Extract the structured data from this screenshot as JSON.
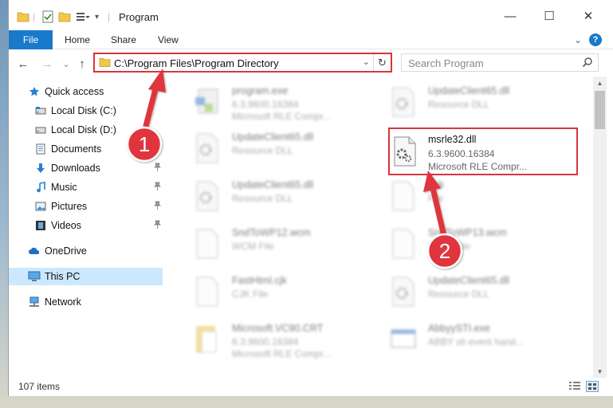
{
  "window": {
    "title": "Program",
    "minimize_glyph": "—",
    "maximize_glyph": "☐",
    "close_glyph": "✕"
  },
  "ribbon": {
    "tabs": [
      "File",
      "Home",
      "Share",
      "View"
    ],
    "expand_glyph": "⌄",
    "help_glyph": "?"
  },
  "nav": {
    "back_glyph": "←",
    "forward_glyph": "→",
    "recent_glyph": "⌄",
    "up_glyph": "↑",
    "address_path": "C:\\Program Files\\Program Directory",
    "address_dropdown_glyph": "⌄",
    "refresh_glyph": "↻",
    "search_placeholder": "Search Program"
  },
  "sidebar": {
    "items": [
      {
        "label": "Quick access",
        "icon": "star-icon"
      },
      {
        "label": "Local Disk (C:)",
        "icon": "drive-icon"
      },
      {
        "label": "Local Disk (D:)",
        "icon": "drive-icon"
      },
      {
        "label": "Documents",
        "icon": "documents-icon"
      },
      {
        "label": "Downloads",
        "icon": "download-arrow-icon",
        "pinned": true
      },
      {
        "label": "Music",
        "icon": "music-note-icon",
        "pinned": true
      },
      {
        "label": "Pictures",
        "icon": "pictures-icon",
        "pinned": true
      },
      {
        "label": "Videos",
        "icon": "film-icon",
        "pinned": true
      },
      {
        "label": "OneDrive",
        "icon": "cloud-icon"
      },
      {
        "label": "This PC",
        "icon": "monitor-icon",
        "selected": true
      },
      {
        "label": "Network",
        "icon": "network-icon"
      }
    ],
    "pin_glyph": "📌"
  },
  "files": [
    {
      "name": "program.exe",
      "line1": "6.3.9600.16384",
      "line2": "Microsoft RLE Compr...",
      "icon": "exe-icon"
    },
    {
      "name": "UpdateClient65.dll",
      "line1": "Resource DLL",
      "line2": "",
      "icon": "dll-gear-icon"
    },
    {
      "name": "UpdateClient65.dll",
      "line1": "Resource DLL",
      "line2": "",
      "icon": "dll-gear-icon"
    },
    {
      "name": "msrle32.dll",
      "line1": "6.3.9600.16384",
      "line2": "Microsoft RLE Compr...",
      "icon": "dll-gear-icon"
    },
    {
      "name": "UpdateClient65.dll",
      "line1": "Resource DLL",
      "line2": "",
      "icon": "dll-gear-icon"
    },
    {
      "name": "bak",
      "line1": "File",
      "line2": "",
      "icon": "blank-file-icon"
    },
    {
      "name": "SndToWP12.wcm",
      "line1": "WCM File",
      "line2": "",
      "icon": "blank-file-icon"
    },
    {
      "name": "SndToWP13.wcm",
      "line1": "WCM File",
      "line2": "",
      "icon": "blank-file-icon"
    },
    {
      "name": "FastHtml.cjk",
      "line1": "CJK File",
      "line2": "",
      "icon": "blank-file-icon"
    },
    {
      "name": "UpdateClient65.dll",
      "line1": "Resource DLL",
      "line2": "",
      "icon": "dll-gear-icon"
    },
    {
      "name": "Microsoft.VC90.CRT",
      "line1": "6.3.9600.16384",
      "line2": "Microsoft RLE Compr...",
      "icon": "folder-file-icon"
    },
    {
      "name": "AbbyySTI.exe",
      "line1": "ABBY sti event hand...",
      "line2": "",
      "icon": "exe-window-icon"
    }
  ],
  "status": {
    "item_count": "107 items"
  },
  "annotations": [
    {
      "label": "1"
    },
    {
      "label": "2"
    }
  ],
  "colors": {
    "accent": "#1979ca",
    "highlight_red": "#d9343b",
    "selected_bg": "#cce8ff"
  }
}
